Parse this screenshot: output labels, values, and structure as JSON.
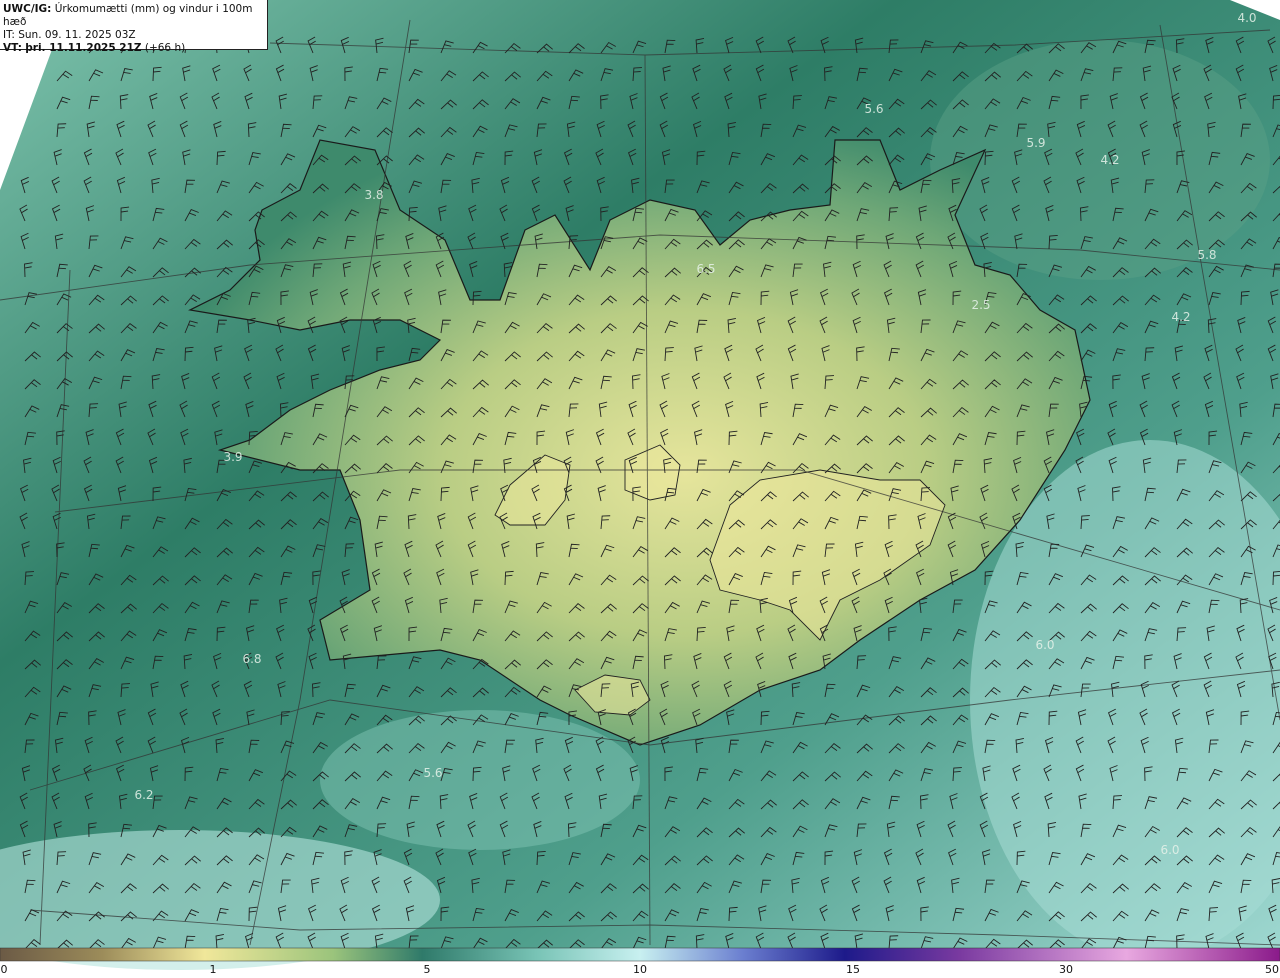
{
  "title": {
    "model": "UWC/IG:",
    "description": "Úrkomumætti (mm) og vindur i 100m hæð",
    "init": "IT: Sun. 09. 11. 2025 03Z",
    "valid_prefix": "VT:",
    "valid": "þri. 11.11.2025 21Z",
    "lead": "(+66 h)"
  },
  "colorbar": {
    "ticks": [
      "0",
      "1",
      "5",
      "10",
      "15",
      "30",
      "50"
    ],
    "stops": [
      {
        "pos": 0.0,
        "color": "#6b5a45"
      },
      {
        "pos": 0.08,
        "color": "#9c8c5a"
      },
      {
        "pos": 0.16,
        "color": "#f0e79a"
      },
      {
        "pos": 0.26,
        "color": "#9bc47c"
      },
      {
        "pos": 0.33,
        "color": "#2f7a6a"
      },
      {
        "pos": 0.42,
        "color": "#79c4b6"
      },
      {
        "pos": 0.5,
        "color": "#c8f0f0"
      },
      {
        "pos": 0.58,
        "color": "#6b7fd0"
      },
      {
        "pos": 0.66,
        "color": "#1d1a8a"
      },
      {
        "pos": 0.75,
        "color": "#7a3aa0"
      },
      {
        "pos": 0.88,
        "color": "#e8a8e0"
      },
      {
        "pos": 1.0,
        "color": "#8a1a8a"
      }
    ]
  },
  "value_labels": [
    {
      "text": "4.0",
      "lon": 1247,
      "lat": 22
    },
    {
      "text": "5.6",
      "lon": 874,
      "lat": 113
    },
    {
      "text": "5.9",
      "lon": 1036,
      "lat": 147
    },
    {
      "text": "4.2",
      "lon": 1110,
      "lat": 164
    },
    {
      "text": "3.8",
      "lon": 374,
      "lat": 199
    },
    {
      "text": "5.8",
      "lon": 1207,
      "lat": 259
    },
    {
      "text": "6.5",
      "lon": 706,
      "lat": 273
    },
    {
      "text": "2.5",
      "lon": 981,
      "lat": 309
    },
    {
      "text": "4.2",
      "lon": 1181,
      "lat": 321
    },
    {
      "text": "3.9",
      "lon": 233,
      "lat": 461
    },
    {
      "text": "6.0",
      "lon": 1045,
      "lat": 649
    },
    {
      "text": "6.8",
      "lon": 252,
      "lat": 663
    },
    {
      "text": "5.6",
      "lon": 433,
      "lat": 777
    },
    {
      "text": "6.2",
      "lon": 144,
      "lat": 799
    },
    {
      "text": "6.0",
      "lon": 1170,
      "lat": 854
    }
  ],
  "colors": {
    "ocean_dark": "#2f7a66",
    "ocean_light": "#8fd0c4",
    "land_high": "#e2e49a",
    "land_mid": "#8cb47a",
    "coastline": "#1a1a1a",
    "barb": "#222222",
    "graticule": "#333333"
  }
}
